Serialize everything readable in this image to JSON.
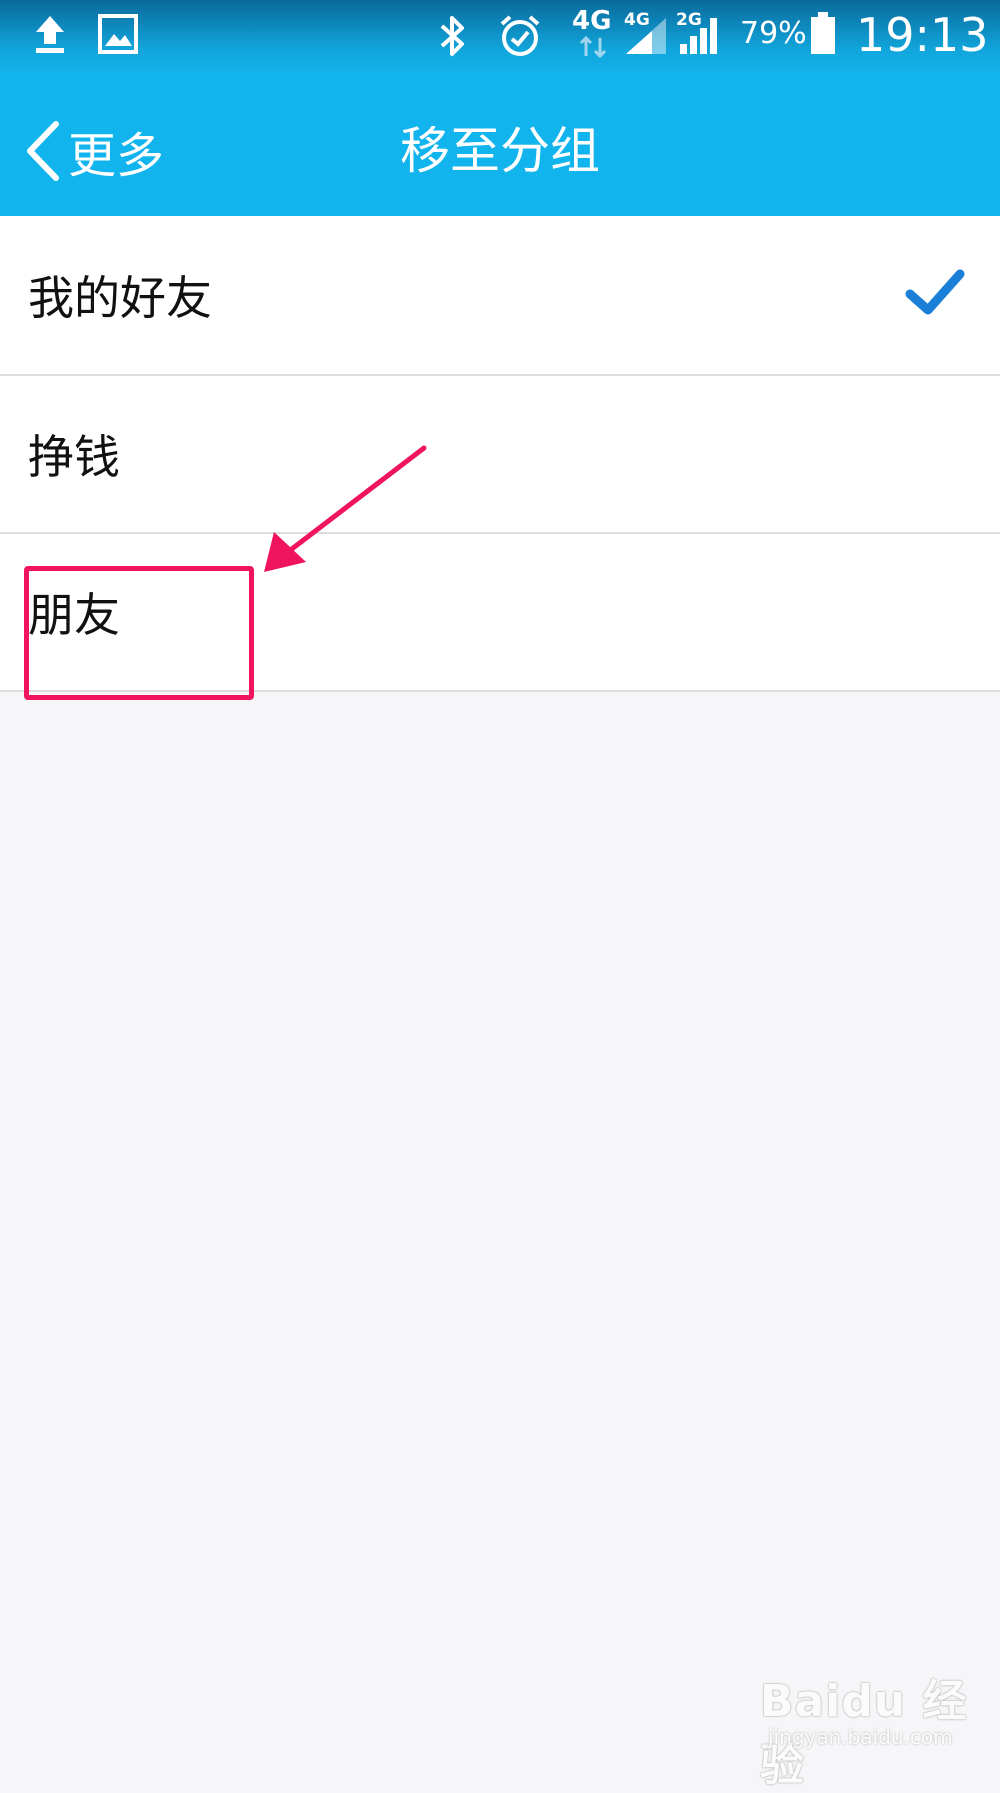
{
  "status_bar": {
    "network_primary": "4G",
    "sim1_label": "4G",
    "sim2_label": "2G",
    "battery_percent": "79%",
    "time": "19:13",
    "icons": [
      "upload-icon",
      "gallery-icon",
      "bluetooth-icon",
      "alarm-icon",
      "signal-icon",
      "battery-icon"
    ]
  },
  "nav": {
    "back_label": "更多",
    "title": "移至分组"
  },
  "groups": [
    {
      "label": "我的好友",
      "selected": true
    },
    {
      "label": "挣钱",
      "selected": false
    },
    {
      "label": "朋友",
      "selected": false
    }
  ],
  "watermark": {
    "brand": "Baidu 经验",
    "url": "jingyan.baidu.com"
  },
  "colors": {
    "nav_bg": "#12b4ed",
    "check": "#1a7fd6",
    "annotation": "#f0145f",
    "page_bg": "#f6f6f9"
  }
}
